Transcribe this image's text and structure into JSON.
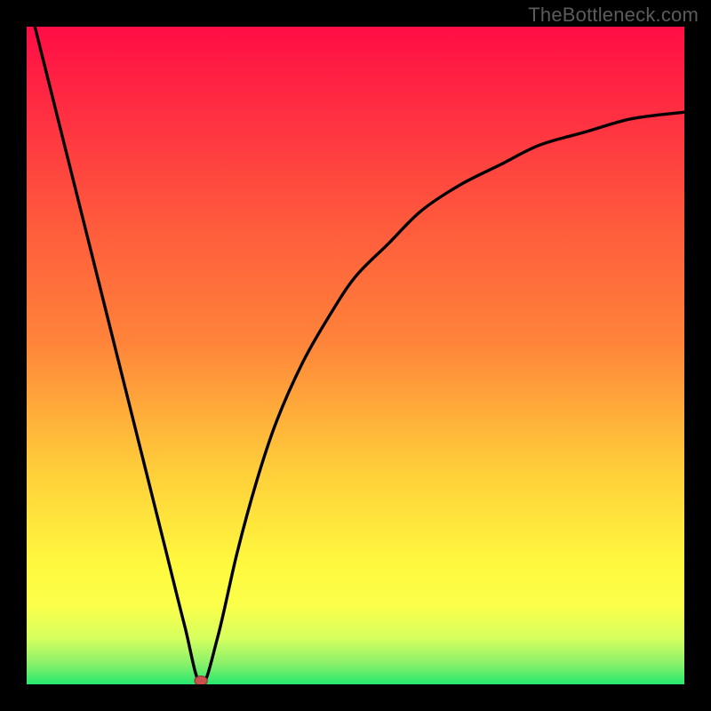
{
  "watermark": "TheBottleneck.com",
  "chart_data": {
    "type": "line",
    "title": "",
    "xlabel": "",
    "ylabel": "",
    "xlim": [
      0,
      1
    ],
    "ylim": [
      0,
      1
    ],
    "annotations": [],
    "colors": {
      "curve": "#000000",
      "marker_fill": "#c9504d",
      "marker_stroke": "#8c2f2d",
      "gradient_top": "#ff0d46",
      "gradient_mid_upper": "#ff843a",
      "gradient_mid": "#ffd03a",
      "gradient_mid_lower": "#fff93e",
      "gradient_low": "#d6ff5e",
      "gradient_bottom": "#26e86f"
    },
    "marker": {
      "x": 0.265,
      "y": 0.0
    },
    "series": [
      {
        "name": "curve",
        "x": [
          0.0,
          0.03,
          0.06,
          0.09,
          0.12,
          0.15,
          0.18,
          0.21,
          0.24,
          0.265,
          0.29,
          0.32,
          0.35,
          0.38,
          0.42,
          0.46,
          0.5,
          0.55,
          0.6,
          0.66,
          0.72,
          0.78,
          0.85,
          0.92,
          1.0
        ],
        "y": [
          1.05,
          0.93,
          0.81,
          0.69,
          0.57,
          0.45,
          0.33,
          0.21,
          0.09,
          0.0,
          0.07,
          0.2,
          0.31,
          0.4,
          0.49,
          0.56,
          0.62,
          0.67,
          0.72,
          0.76,
          0.79,
          0.82,
          0.84,
          0.86,
          0.87
        ]
      }
    ]
  }
}
